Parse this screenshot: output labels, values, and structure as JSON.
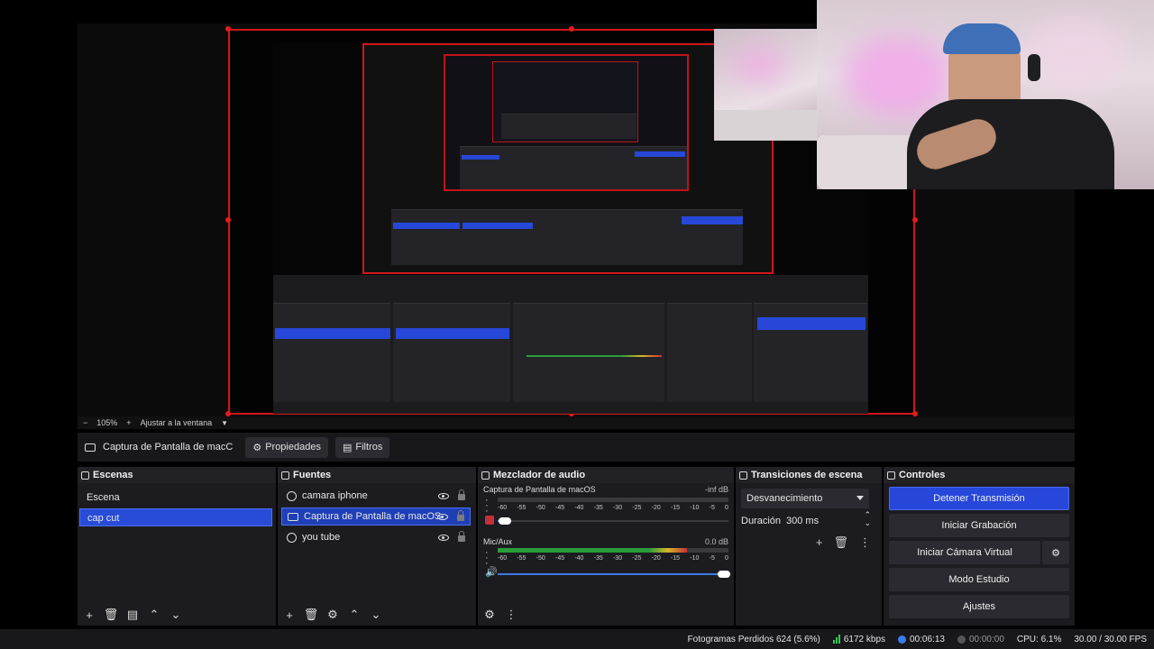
{
  "zoom": {
    "level": "105%",
    "fit_label": "Ajustar a la ventana"
  },
  "source_toolbar": {
    "source_name": "Captura de Pantalla de macC",
    "properties_label": "Propiedades",
    "filters_label": "Filtros"
  },
  "scenes": {
    "title": "Escenas",
    "items": [
      {
        "label": "Escena",
        "selected": false
      },
      {
        "label": "cap cut",
        "selected": true
      }
    ]
  },
  "sources": {
    "title": "Fuentes",
    "items": [
      {
        "label": "camara iphone",
        "icon": "globe-icon",
        "selected": false
      },
      {
        "label": "Captura de Pantalla de macOS",
        "icon": "monitor-icon",
        "selected": true
      },
      {
        "label": "you tube",
        "icon": "globe-icon",
        "selected": false
      }
    ]
  },
  "mixer": {
    "title": "Mezclador de audio",
    "tick_labels": [
      "-60",
      "-55",
      "-50",
      "-45",
      "-40",
      "-35",
      "-30",
      "-25",
      "-20",
      "-15",
      "-10",
      "-5",
      "0"
    ],
    "channels": [
      {
        "name": "Captura de Pantalla de macOS",
        "db": "-inf dB",
        "meter_level": 0.0,
        "volume": 0.03
      },
      {
        "name": "Mic/Aux",
        "db": "0.0 dB",
        "meter_level": 0.82,
        "volume": 0.98
      }
    ]
  },
  "transitions": {
    "title": "Transiciones de escena",
    "selected": "Desvanecimiento",
    "duration_label": "Duración",
    "duration_value": "300 ms"
  },
  "controls": {
    "title": "Controles",
    "stop_stream": "Detener Transmisión",
    "start_recording": "Iniciar Grabación",
    "start_virtual_cam": "Iniciar Cámara Virtual",
    "studio_mode": "Modo Estudio",
    "settings": "Ajustes"
  },
  "status": {
    "dropped_frames": "Fotogramas Perdidos 624 (5.6%)",
    "bitrate": "6172 kbps",
    "stream_time": "00:06:13",
    "record_time": "00:00:00",
    "cpu": "CPU: 6.1%",
    "fps": "30.00 / 30.00 FPS"
  },
  "colors": {
    "accent": "#2647d9",
    "selection_frame": "#d2161b",
    "meter_green": "#2a9c3a",
    "meter_yellow": "#d8b52a",
    "meter_red": "#c33333"
  }
}
